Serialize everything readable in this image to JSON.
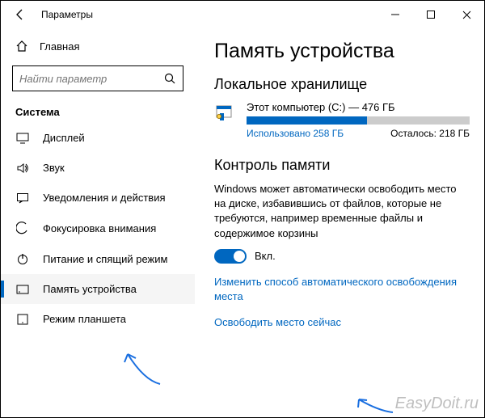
{
  "titlebar": {
    "title": "Параметры"
  },
  "sidebar": {
    "home": "Главная",
    "search_placeholder": "Найти параметр",
    "section": "Система",
    "items": [
      {
        "label": "Дисплей"
      },
      {
        "label": "Звук"
      },
      {
        "label": "Уведомления и действия"
      },
      {
        "label": "Фокусировка внимания"
      },
      {
        "label": "Питание и спящий режим"
      },
      {
        "label": "Память устройства"
      },
      {
        "label": "Режим планшета"
      }
    ]
  },
  "main": {
    "page_title": "Память устройства",
    "local_storage_hdr": "Локальное хранилище",
    "drive": {
      "name": "Этот компьютер (C:) — 476 ГБ",
      "used_label": "Использовано 258 ГБ",
      "free_label": "Осталось: 218 ГБ",
      "used_pct": 54
    },
    "storage_sense_hdr": "Контроль памяти",
    "desc": "Windows может автоматически освободить место на диске, избавившись от файлов, которые не требуются, например временные файлы и содержимое корзины",
    "toggle_label": "Вкл.",
    "link_change": "Изменить способ автоматического освобождения места",
    "link_free": "Освободить место сейчас"
  },
  "watermark": "EasyDoit.ru"
}
